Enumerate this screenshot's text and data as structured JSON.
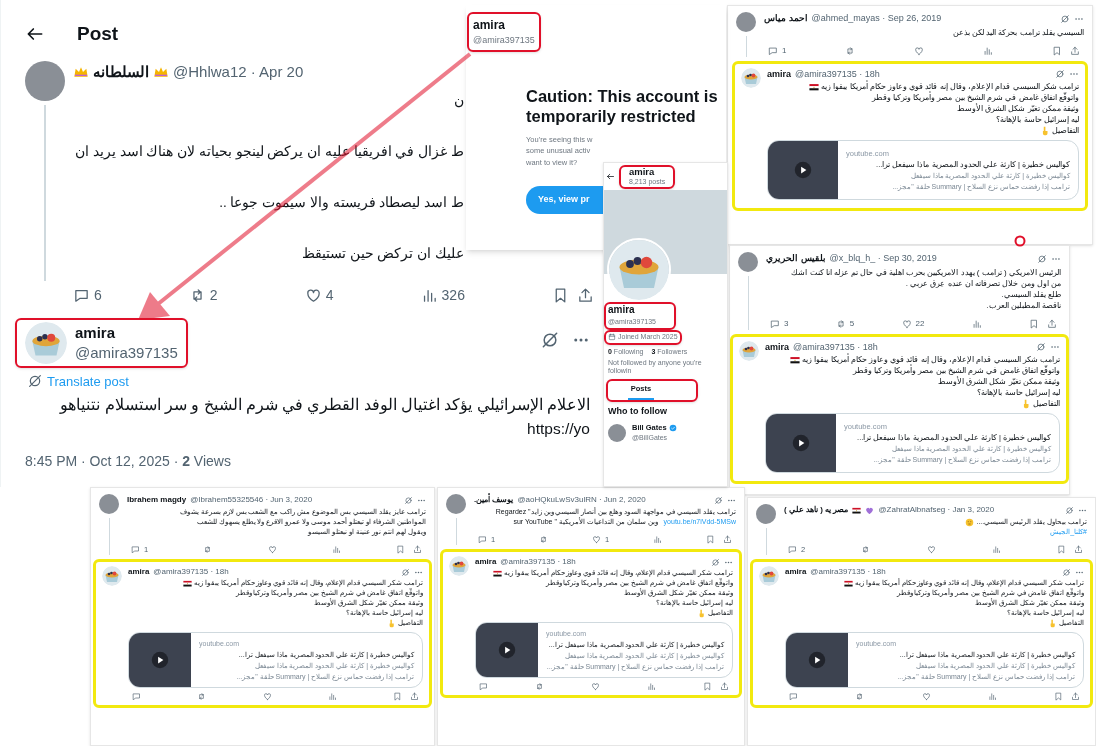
{
  "main_post": {
    "title": "Post",
    "tweet": {
      "name": "السلطانه",
      "meta": "@Hhlwa12 · Apr 20",
      "text_lines": [
        {
          "text": "ن"
        },
        {
          "text": "ط غزال في افريقيا عليه ان يركض لينجو بحياته لان هناك اسد يريد ان"
        },
        {
          "text": "ط اسد ليصطاد فريسته والا سيموت جوعا .."
        },
        {
          "text": "عليك ان تركض حين تستيقظ"
        }
      ],
      "stats": {
        "replies": "6",
        "reposts": "2",
        "likes": "4",
        "views": "326"
      }
    },
    "reply": {
      "name": "amira",
      "handle": "@amira397135",
      "author_marked": true,
      "translate": "Translate post",
      "text_lines": [
        "الاعلام الإسرائيلي يؤكد اغتيال الوفد القطري في شرم الشيخ و سر استسلام نتنياهو",
        "https://yo"
      ],
      "footer": "8:45 PM · Oct 12, 2025 · **2** Views"
    }
  },
  "caution_panel": {
    "author_name": "amira",
    "author_handle": "@amira397135",
    "author_marked": true,
    "title": "Caution: This account is temporarily restricted",
    "message_lines": [
      "You’re seeing this w",
      "some unusual activ",
      "want to view it?"
    ],
    "button": "Yes, view pr"
  },
  "profile_panel": {
    "header_name": "amira",
    "post_count": "8,213 posts",
    "header_marked": true,
    "name": "amira",
    "handle": "@amira397135",
    "name_marked": true,
    "joined": "Joined March 2025",
    "joined_marked": true,
    "following_count": "0",
    "following_label": "Following",
    "followers_count": "3",
    "followers_label": "Followers",
    "note": "Not followed by anyone you're followin",
    "tabs": [
      {
        "label": "Posts",
        "selected": true
      }
    ],
    "tabs_marked": true,
    "who_to_follow": "Who to follow",
    "suggestion": {
      "name": "Bill Gates",
      "handle": "@BillGates",
      "verified": true
    }
  },
  "threads": [
    {
      "parent": {
        "name": "احمد مياس",
        "meta": "@ahmed_mayas · Sep 26, 2019",
        "text_lines": [
          {
            "text": "السيسي يقلد ترامب بحركة اليد لكن بذعن"
          }
        ],
        "stats": {
          "replies": "1"
        }
      },
      "reply": {
        "name": "amira",
        "meta": "@amira397135 · 18h",
        "highlighted": true,
        "text_lines": [
          {
            "text": "ترامب شكر السيسي قدام الإعلام، وقال إنه قائد قوي وعاوز حكام أمريكا يبقوا زيه",
            "kind": "flag"
          },
          {
            "text": "واتوقّع اتفاق غامض في شرم الشيخ بين مصر وأمريكا وتركيا وقطر"
          },
          {
            "text": "وثيقة ممكن تغيّر شكل الشرق الأوسط"
          },
          {
            "text": "ليه إسرائيل حاسة بالإهانة؟"
          },
          {
            "text": "التفاصيل",
            "kind": "pointer"
          }
        ],
        "card": {
          "domain": "youtube.com",
          "title": "كواليس خطيرة | كارثة علي الحدود المصرية ماذا سيفعل ترا...",
          "desc_lines": [
            "كواليس خطيرة | كارثة علي الحدود المصرية ماذا سيفعل",
            "ترامب إذا رفضت حماس نزع السلاح | Summary حلقة \"مجز..."
          ]
        },
        "actions_shown": false
      }
    },
    {
      "parent": {
        "name": "بلقيس الحريري",
        "meta": "@x_blq_h_ · Sep 30, 2019",
        "text_lines": [
          {
            "text": "الرئيس الامريكي ( ترامب ) يهدد الامريكيين بحرب اهلية  في حال تم عزله انا كنت اشك"
          },
          {
            "text": "من اول ومن خلال تصرفاته ان عنده عِرق عربي ."
          },
          {
            "text": "طلع يقلد السيسي."
          },
          {
            "text": "ناقصة المطبلين العرب."
          }
        ],
        "stats": {
          "replies": "3",
          "reposts": "5",
          "likes": "22"
        }
      },
      "reply": {
        "name": "amira",
        "meta": "@amira397135 · 18h",
        "highlighted": true,
        "text_lines": [
          {
            "text": "ترامب شكر السيسي قدام الإعلام، وقال إنه قائد قوي وعاوز حكام أمريكا يبقوا زيه",
            "kind": "flag"
          },
          {
            "text": "واتوقّع اتفاق غامض في شرم الشيخ بين مصر وأمريكا وتركيا وقطر"
          },
          {
            "text": "وثيقة ممكن تغيّر شكل الشرق الأوسط"
          },
          {
            "text": "ليه إسرائيل حاسة بالإهانة؟"
          },
          {
            "text": "التفاصيل",
            "kind": "pointer"
          }
        ],
        "card": {
          "domain": "youtube.com",
          "title": "كواليس خطيرة | كارثة علي الحدود المصرية ماذا سيفعل ترا...",
          "desc_lines": [
            "كواليس خطيرة | كارثة علي الحدود المصرية ماذا سيفعل",
            "ترامب إذا رفضت حماس نزع السلاح | Summary حلقة \"مجز..."
          ]
        },
        "actions_shown": false
      }
    },
    {
      "parent": {
        "name": "Ibrahem magdy",
        "meta": "@Ibrahem55325546 · Jun 3, 2020",
        "text_lines": [
          {
            "text": "ترامب عايز يقلد السيسي بس الموضوع مش راكب مع الشعب بس لازم بسرعة يشوف"
          },
          {
            "text": "المواطنين الشرفاء او تبعتلو  أحمد موسى ولا عمرو الاقرع ولا يطلع يسهوك للشعب"
          },
          {
            "text": "ويقول لهم انتم نور عنينة او نبعتلو السيسو"
          }
        ],
        "stats": {
          "replies": "1"
        }
      },
      "reply": {
        "name": "amira",
        "meta": "@amira397135 · 18h",
        "highlighted": true,
        "text_lines": [
          {
            "text": "ترامب شكر السيسي قدام الإعلام، وقال إنه قائد قوي وعاوز حكام أمريكا يبقوا زيه",
            "kind": "flag"
          },
          {
            "text": "واتوقّع اتفاق غامض في شرم الشيخ بين مصر وأمريكا وتركيا وقطر"
          },
          {
            "text": "وثيقة ممكن تغيّر شكل الشرق الأوسط"
          },
          {
            "text": "ليه إسرائيل حاسة بالإهانة؟"
          },
          {
            "text": "التفاصيل",
            "kind": "pointer"
          }
        ],
        "card": {
          "domain": "youtube.com",
          "title": "كواليس خطيرة | كارثة علي الحدود المصرية ماذا سيفعل ترا...",
          "desc_lines": [
            "كواليس خطيرة | كارثة علي الحدود المصرية ماذا سيفعل",
            "ترامب إذا رفضت حماس نزع السلاح | Summary حلقة \"مجز..."
          ]
        },
        "actions_shown": true
      }
    },
    {
      "parent": {
        "name": "يوسف أمين.",
        "meta": "@aoHQkuLwSv3ulRN · Jun 2, 2020",
        "text_lines": [
          {
            "text": "ترامب يقلد السيسي في مواجهة السود  وهلع بين أنصار السيسي وبن زايد\" Regardez"
          },
          {
            "text": "وبن سلمان من التداعيات الأمريكية \" sur YouTube",
            "link": "youtu.be/n7iVdd-5MSw"
          }
        ],
        "stats": {
          "replies": "1",
          "likes": "1"
        }
      },
      "reply": {
        "name": "amira",
        "meta": "@amira397135 · 18h",
        "highlighted": true,
        "text_lines": [
          {
            "text": "ترامب شكر السيسي قدام الإعلام، وقال إنه قائد قوي وعاوز حكام أمريكا يبقوا زيه",
            "kind": "flag"
          },
          {
            "text": "واتوقّع اتفاق غامض في شرم الشيخ بين مصر وأمريكا وتركيا وقطر"
          },
          {
            "text": "وثيقة ممكن تغيّر شكل الشرق الأوسط"
          },
          {
            "text": "ليه إسرائيل حاسة بالإهانة؟"
          },
          {
            "text": "التفاصيل",
            "kind": "pointer"
          }
        ],
        "card": {
          "domain": "youtube.com",
          "title": "كواليس خطيرة | كارثة علي الحدود المصرية ماذا سيفعل ترا...",
          "desc_lines": [
            "كواليس خطيرة | كارثة علي الحدود المصرية ماذا سيفعل",
            "ترامب إذا رفضت حماس نزع السلاح | Summary حلقة \"مجز..."
          ]
        },
        "actions_shown": true
      }
    },
    {
      "parent": {
        "name": "مصر يه ( ناهد علي )",
        "meta": "@ZahratAlbnafseg · Jan 3, 2020",
        "text_lines": [
          {
            "text": "ترامب بيحاول يقلد الرئيس السيسي....",
            "kind": "thinking"
          },
          {
            "text": "#كلنا_الجيش",
            "kind": "hashtag"
          }
        ],
        "stats": {
          "replies": "2"
        }
      },
      "reply": {
        "name": "amira",
        "meta": "@amira397135 · 18h",
        "highlighted": true,
        "text_lines": [
          {
            "text": "ترامب شكر السيسي قدام الإعلام، وقال إنه قائد قوي وعاوز حكام أمريكا يبقوا زيه",
            "kind": "flag"
          },
          {
            "text": "واتوقّع اتفاق غامض في شرم الشيخ بين مصر وأمريكا وتركيا وقطر"
          },
          {
            "text": "وثيقة ممكن تغيّر شكل الشرق الأوسط"
          },
          {
            "text": "ليه إسرائيل حاسة بالإهانة؟"
          },
          {
            "text": "التفاصيل",
            "kind": "pointer"
          }
        ],
        "card": {
          "domain": "youtube.com",
          "title": "كواليس خطيرة | كارثة علي الحدود المصرية ماذا سيفعل ترا...",
          "desc_lines": [
            "كواليس خطيرة | كارثة علي الحدود المصرية ماذا سيفعل",
            "ترامب إذا رفضت حماس نزع السلاح | Summary حلقة \"مجز..."
          ]
        },
        "actions_shown": true
      }
    }
  ]
}
